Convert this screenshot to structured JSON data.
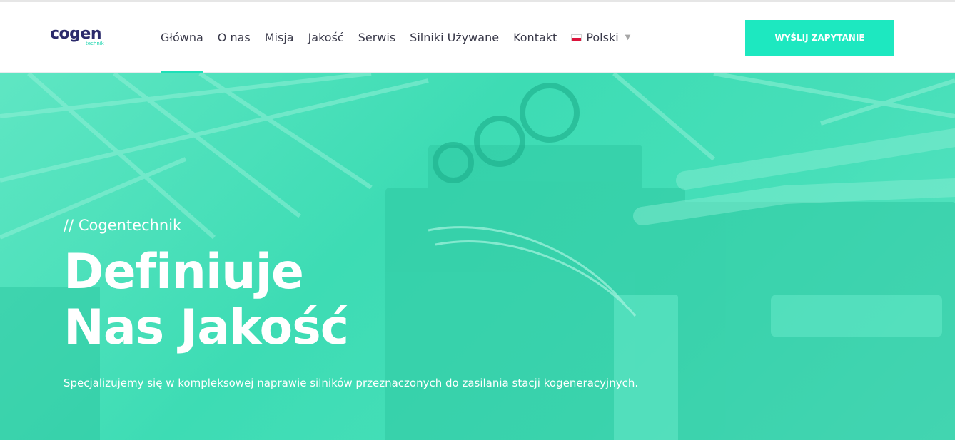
{
  "header": {
    "logo": {
      "main": "cogen",
      "sub": "technik"
    },
    "nav": [
      {
        "label": "Główna",
        "active": true
      },
      {
        "label": "O nas"
      },
      {
        "label": "Misja"
      },
      {
        "label": "Jakość"
      },
      {
        "label": "Serwis"
      },
      {
        "label": "Silniki Używane"
      },
      {
        "label": "Kontakt"
      }
    ],
    "language": {
      "label": "Polski",
      "icon": "flag-poland-icon"
    },
    "cta_label": "WYŚLIJ ZAPYTANIE"
  },
  "hero": {
    "kicker": "// Cogentechnik",
    "title_line1": "Definiuje",
    "title_line2": "Nas Jakość",
    "description": "Specjalizujemy się w kompleksowej naprawie silników przeznaczonych do zasilania stacji kogeneracyjnych."
  },
  "colors": {
    "accent": "#1de8c0",
    "hero_overlay": "#3ddcb4",
    "logo_dark": "#2b2a6b",
    "nav_text": "#3a3a4a"
  }
}
